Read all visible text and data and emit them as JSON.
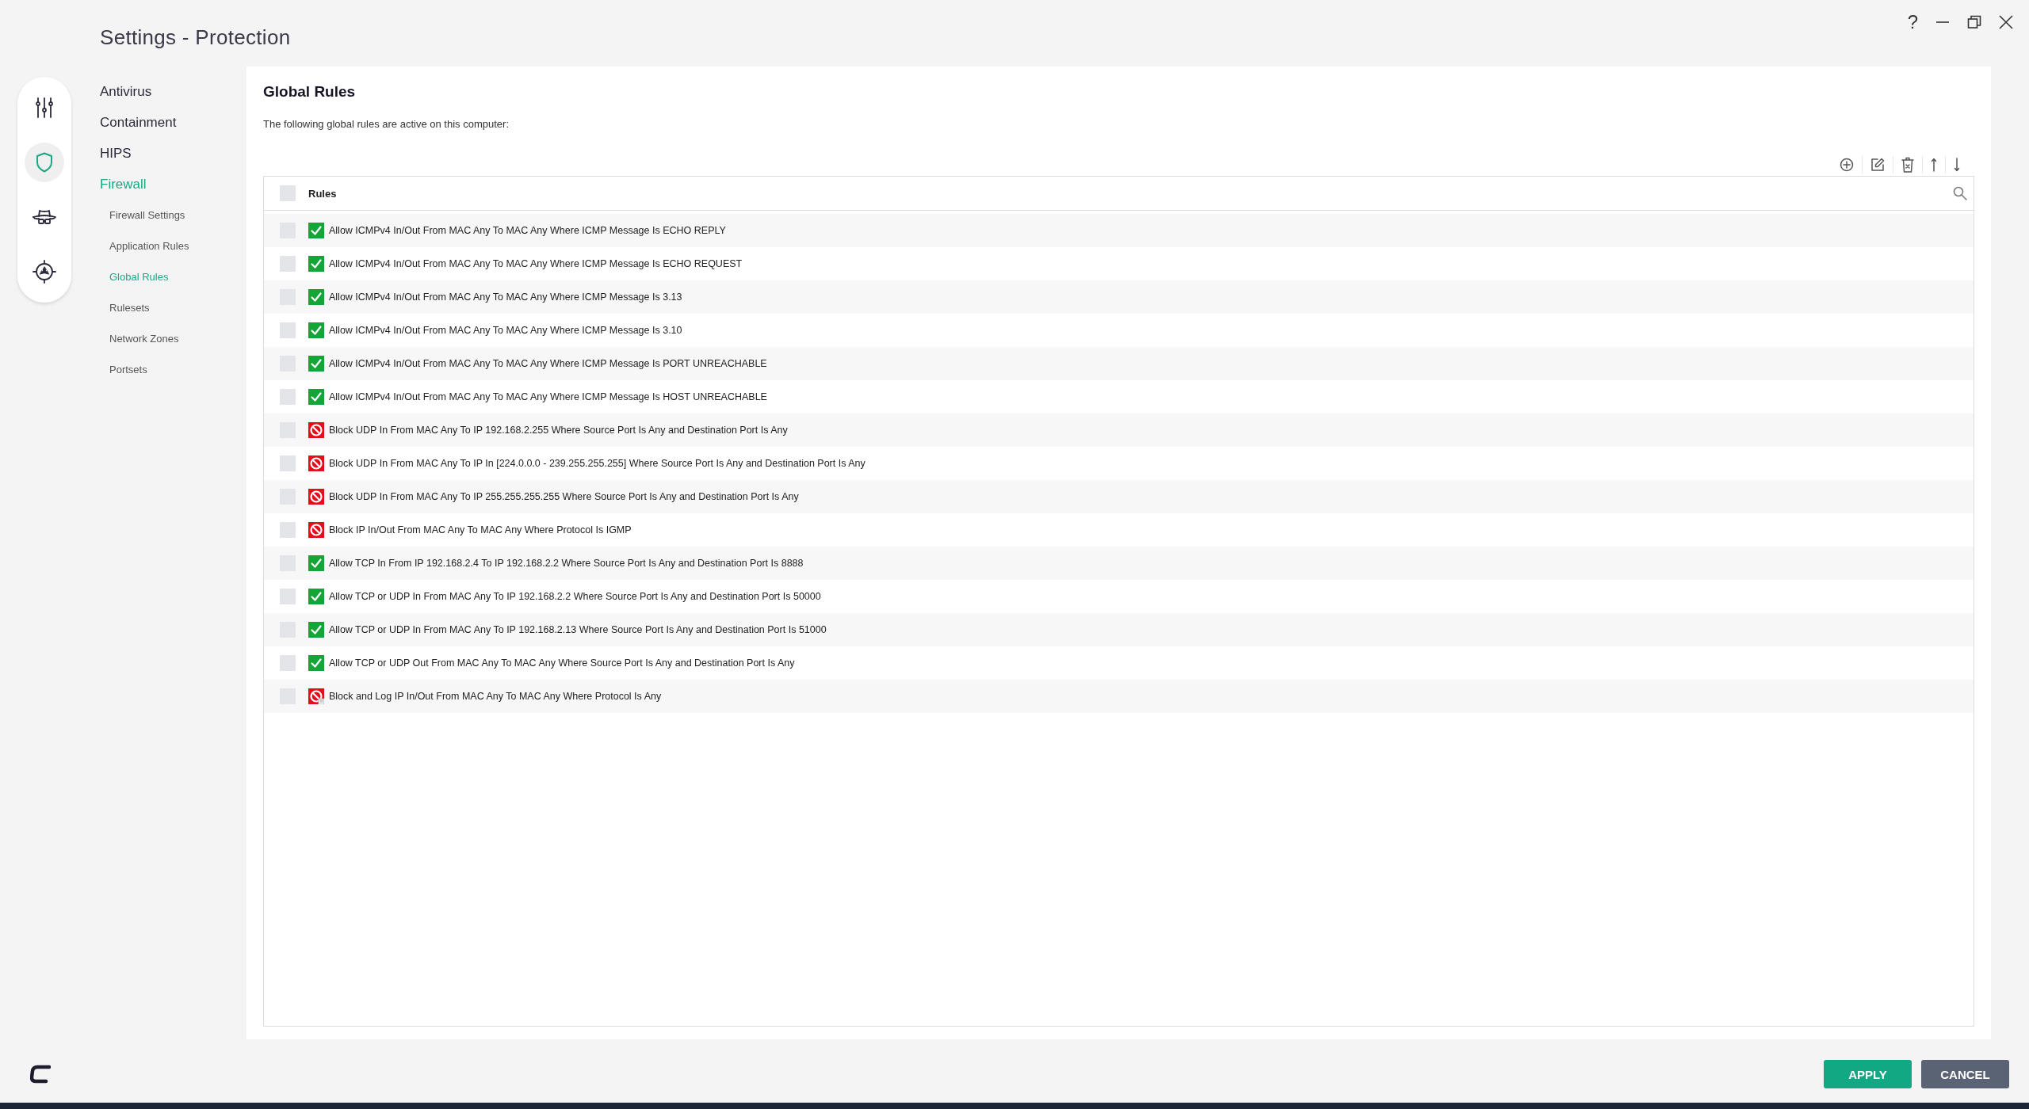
{
  "window": {
    "title": "Settings - Protection",
    "controls": [
      "?"
    ]
  },
  "rail": [
    {
      "kind": "sliders",
      "selected": false
    },
    {
      "kind": "shield",
      "selected": true
    },
    {
      "kind": "spy",
      "selected": false
    },
    {
      "kind": "hazard",
      "selected": false
    }
  ],
  "nav": [
    {
      "label": "Antivirus",
      "selected": false
    },
    {
      "label": "Containment",
      "selected": false
    },
    {
      "label": "HIPS",
      "selected": false
    },
    {
      "label": "Firewall",
      "selected": true,
      "children": [
        {
          "label": "Firewall Settings",
          "selected": false
        },
        {
          "label": "Application Rules",
          "selected": false
        },
        {
          "label": "Global Rules",
          "selected": true
        },
        {
          "label": "Rulesets",
          "selected": false
        },
        {
          "label": "Network Zones",
          "selected": false
        },
        {
          "label": "Portsets",
          "selected": false
        }
      ]
    }
  ],
  "page": {
    "heading": "Global Rules",
    "description": "The following global rules are active on this computer:"
  },
  "table": {
    "column": "Rules",
    "header_checked": false,
    "rows": [
      {
        "kind": "allow",
        "checked": false,
        "text": "Allow ICMPv4 In/Out From MAC Any To MAC Any Where ICMP Message Is ECHO REPLY"
      },
      {
        "kind": "allow",
        "checked": false,
        "text": "Allow ICMPv4 In/Out From MAC Any To MAC Any Where ICMP Message Is ECHO REQUEST"
      },
      {
        "kind": "allow",
        "checked": false,
        "text": "Allow ICMPv4 In/Out From MAC Any To MAC Any Where ICMP Message Is 3.13"
      },
      {
        "kind": "allow",
        "checked": false,
        "text": "Allow ICMPv4 In/Out From MAC Any To MAC Any Where ICMP Message Is 3.10"
      },
      {
        "kind": "allow",
        "checked": false,
        "text": "Allow ICMPv4 In/Out From MAC Any To MAC Any Where ICMP Message Is PORT UNREACHABLE"
      },
      {
        "kind": "allow",
        "checked": false,
        "text": "Allow ICMPv4 In/Out From MAC Any To MAC Any Where ICMP Message Is HOST UNREACHABLE"
      },
      {
        "kind": "block",
        "checked": false,
        "text": "Block UDP In From MAC Any To IP 192.168.2.255 Where Source Port Is Any and Destination Port Is Any"
      },
      {
        "kind": "block",
        "checked": false,
        "text": "Block UDP In From MAC Any To IP In [224.0.0.0 - 239.255.255.255] Where Source Port Is Any and Destination Port Is Any"
      },
      {
        "kind": "block",
        "checked": false,
        "text": "Block UDP In From MAC Any To IP 255.255.255.255 Where Source Port Is Any and Destination Port Is Any"
      },
      {
        "kind": "block",
        "checked": false,
        "text": "Block IP In/Out From MAC Any To MAC Any Where Protocol Is IGMP"
      },
      {
        "kind": "allow",
        "checked": false,
        "text": "Allow TCP In From IP 192.168.2.4 To IP 192.168.2.2 Where Source Port Is Any and Destination Port Is 8888"
      },
      {
        "kind": "allow",
        "checked": false,
        "text": "Allow TCP or UDP In From MAC Any To IP 192.168.2.2 Where Source Port Is Any and Destination Port Is 50000"
      },
      {
        "kind": "allow",
        "checked": false,
        "text": "Allow TCP or UDP In From MAC Any To IP 192.168.2.13 Where Source Port Is Any and Destination Port Is 51000"
      },
      {
        "kind": "allow",
        "checked": false,
        "text": "Allow TCP or UDP Out From MAC Any To MAC Any Where Source Port Is Any and Destination Port Is Any"
      },
      {
        "kind": "block-log",
        "checked": false,
        "text": "Block and Log IP In/Out From MAC Any To MAC Any Where Protocol Is Any"
      }
    ]
  },
  "buttons": [
    {
      "kind": "primary",
      "label": "APPLY"
    },
    {
      "kind": "secondary",
      "label": "CANCEL"
    }
  ]
}
